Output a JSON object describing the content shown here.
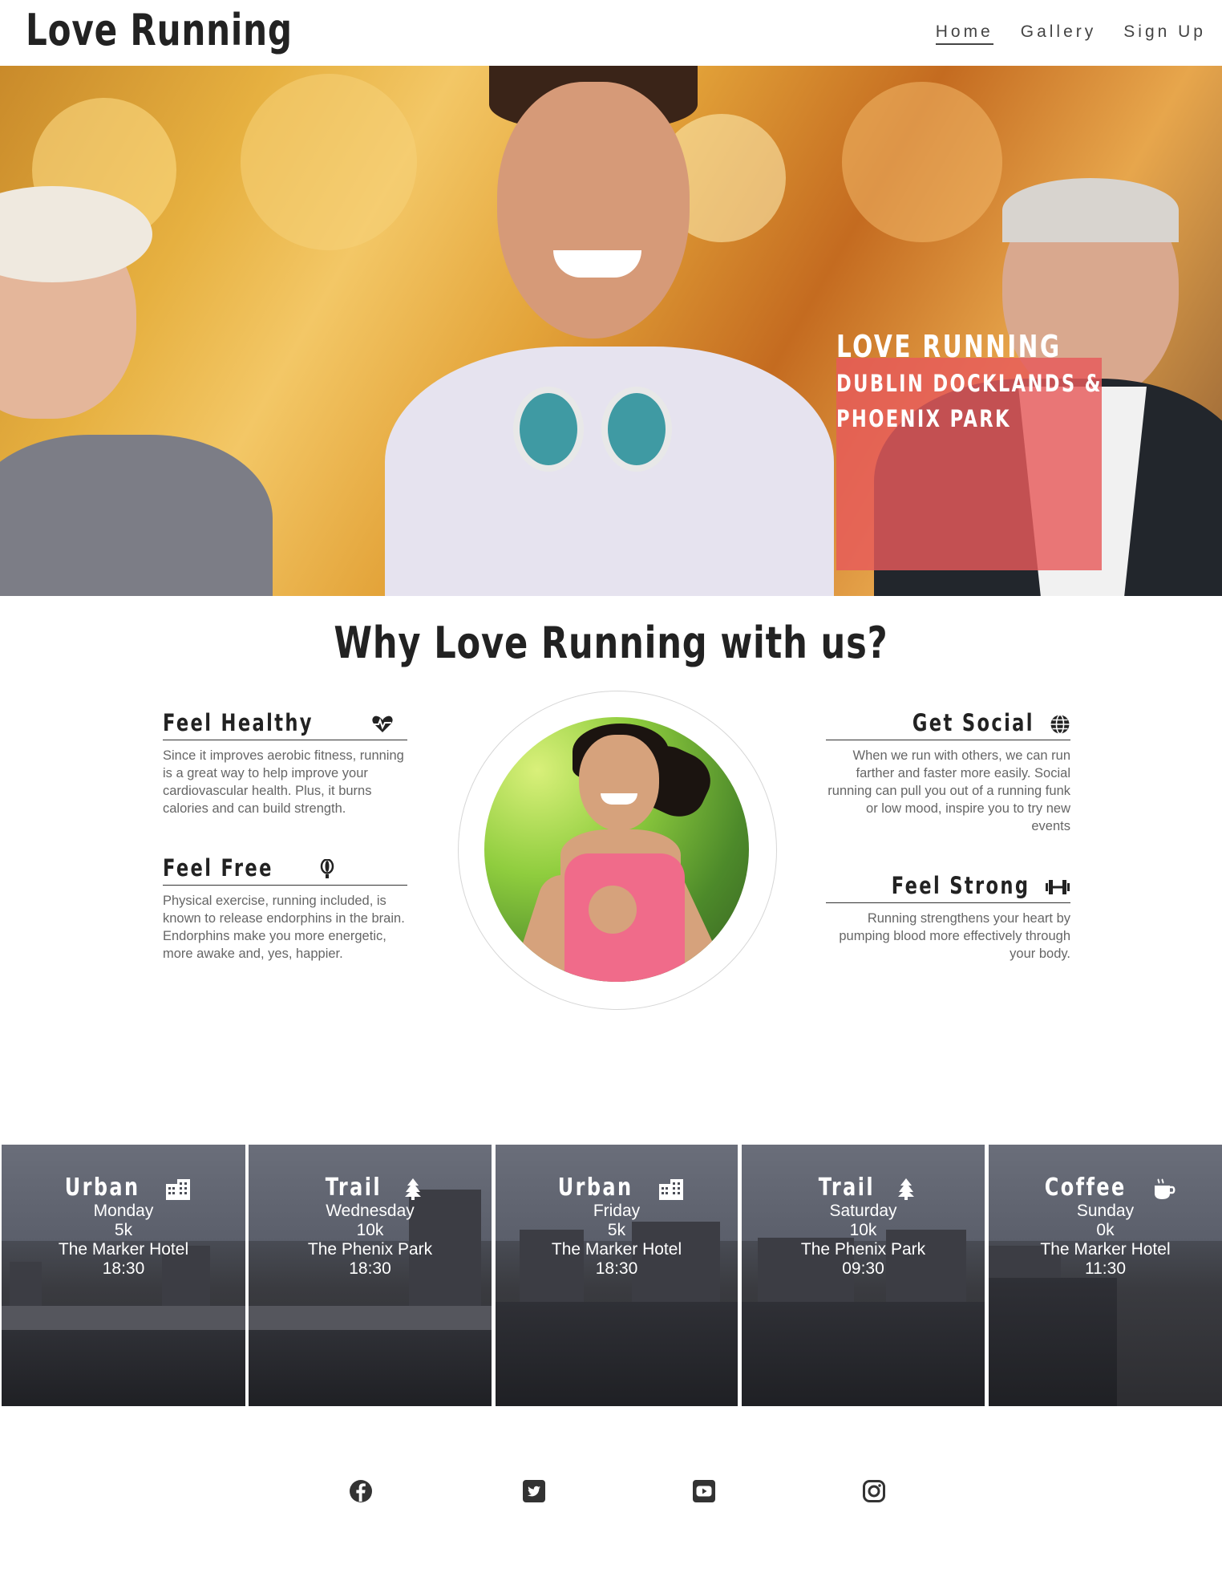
{
  "brand": "Love Running",
  "nav": {
    "home": "Home",
    "gallery": "Gallery",
    "signup": "Sign Up"
  },
  "hero": {
    "line1": "LOVE RUNNING",
    "line2": "DUBLIN DOCKLANDS &",
    "line3": "PHOENIX PARK"
  },
  "why": {
    "title": "Why Love Running with us?",
    "features": [
      {
        "title": "Feel Healthy",
        "icon": "heartbeat-icon",
        "text": "Since it improves aerobic fitness, running is a great way to help improve your cardiovascular health. Plus, it burns calories and can build strength."
      },
      {
        "title": "Feel Free",
        "icon": "balloon-icon",
        "text": "Physical exercise, running included, is known to release endorphins in the brain. Endorphins make you more energetic, more awake and, yes, happier."
      },
      {
        "title": "Get Social",
        "icon": "globe-icon",
        "text": "When we run with others, we can run farther and faster more easily. Social running can pull you out of a running funk or low mood, inspire you to try new events"
      },
      {
        "title": "Feel Strong",
        "icon": "dumbbell-icon",
        "text": "Running strengthens your heart by pumping blood more effectively through your body."
      }
    ]
  },
  "runs": [
    {
      "type": "Urban",
      "icon": "city-icon",
      "day": "Monday",
      "distance": "5k",
      "venue": "The Marker Hotel",
      "time": "18:30"
    },
    {
      "type": "Trail",
      "icon": "tree-icon",
      "day": "Wednesday",
      "distance": "10k",
      "venue": "The Phenix Park",
      "time": "18:30"
    },
    {
      "type": "Urban",
      "icon": "city-icon",
      "day": "Friday",
      "distance": "5k",
      "venue": "The Marker Hotel",
      "time": "18:30"
    },
    {
      "type": "Trail",
      "icon": "tree-icon",
      "day": "Saturday",
      "distance": "10k",
      "venue": "The Phenix Park",
      "time": "09:30"
    },
    {
      "type": "Coffee",
      "icon": "coffee-icon",
      "day": "Sunday",
      "distance": "0k",
      "venue": "The Marker Hotel",
      "time": "11:30"
    }
  ],
  "social": [
    "facebook-icon",
    "twitter-icon",
    "youtube-icon",
    "instagram-icon"
  ],
  "colors": {
    "accent": "#e75a5a",
    "text": "#222222",
    "muted": "#666666"
  }
}
